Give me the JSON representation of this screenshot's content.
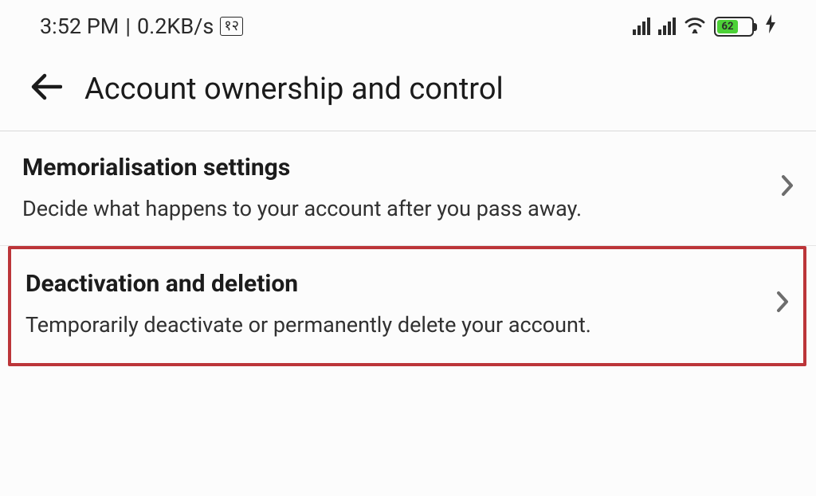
{
  "status": {
    "time": "3:52 PM",
    "transfer": "0.2KB/s",
    "lang": "१२",
    "battery": "62"
  },
  "header": {
    "title": "Account ownership and control"
  },
  "items": [
    {
      "title": "Memorialisation settings",
      "sub": "Decide what happens to your account after you pass away."
    },
    {
      "title": "Deactivation and deletion",
      "sub": "Temporarily deactivate or permanently delete your account."
    }
  ]
}
